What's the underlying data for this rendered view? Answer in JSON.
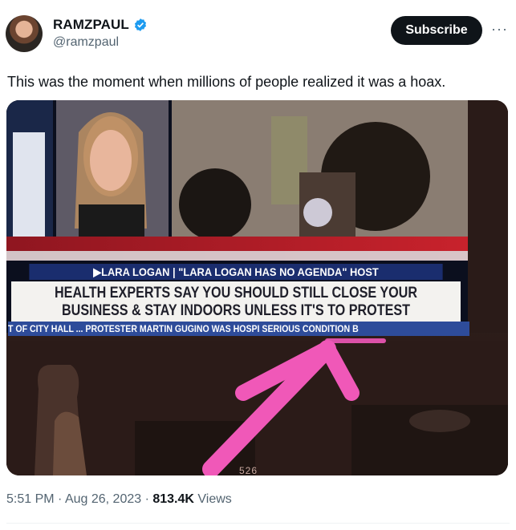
{
  "author": {
    "name": "RAMZPAUL",
    "handle": "@ramzpaul",
    "verified": true
  },
  "header": {
    "subscribe_label": "Subscribe",
    "more_icon": "ellipsis-icon"
  },
  "tweet": {
    "text": "This was the moment when millions of people realized it was a hoax."
  },
  "media": {
    "topic": "▶LARA LOGAN | \"LARA LOGAN HAS NO AGENDA\" HOST",
    "headline_line1": "HEALTH EXPERTS SAY YOU SHOULD STILL CLOSE YOUR",
    "headline_line2": "BUSINESS & STAY INDOORS UNLESS IT'S TO PROTEST",
    "ticker": "T OF CITY HALL ... PROTESTER MARTIN GUGINO WAS HOSPI          SERIOUS CONDITION B",
    "clock": "526",
    "arrow_color": "#f058b8"
  },
  "meta": {
    "time": "5:51 PM",
    "sep1": " · ",
    "date": "Aug 26, 2023",
    "sep2": " · ",
    "views_count": "813.4K",
    "views_label": " Views"
  },
  "colors": {
    "accent": "#1d9bf0",
    "button_bg": "#0f1419",
    "muted": "#536471"
  }
}
